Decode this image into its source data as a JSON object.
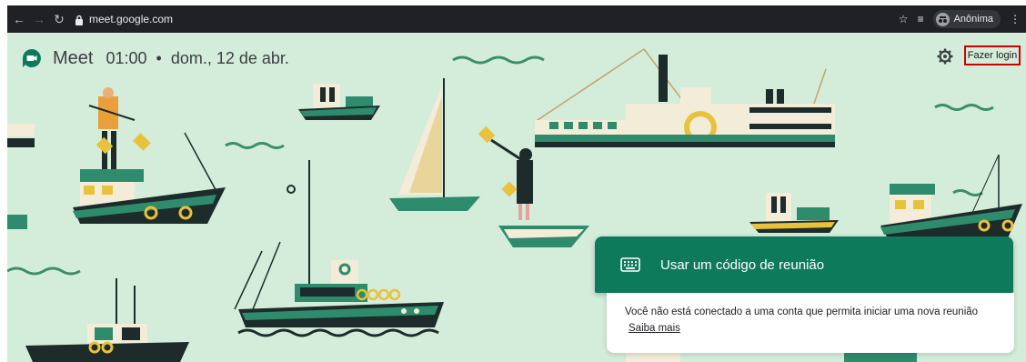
{
  "browser": {
    "url": "meet.google.com",
    "profile_label": "Anônima"
  },
  "header": {
    "app_name": "Meet",
    "time": "01:00",
    "separator": "•",
    "date": "dom., 12 de abr."
  },
  "actions": {
    "login_label": "Fazer login"
  },
  "dialog": {
    "title": "Usar um código de reunião",
    "message": "Você não está conectado a uma conta que permita iniciar uma nova reunião",
    "link_label": "Saiba mais"
  },
  "colors": {
    "background": "#d4ecda",
    "dialog_header": "#0c7a5b",
    "highlight_border": "#d00000"
  }
}
